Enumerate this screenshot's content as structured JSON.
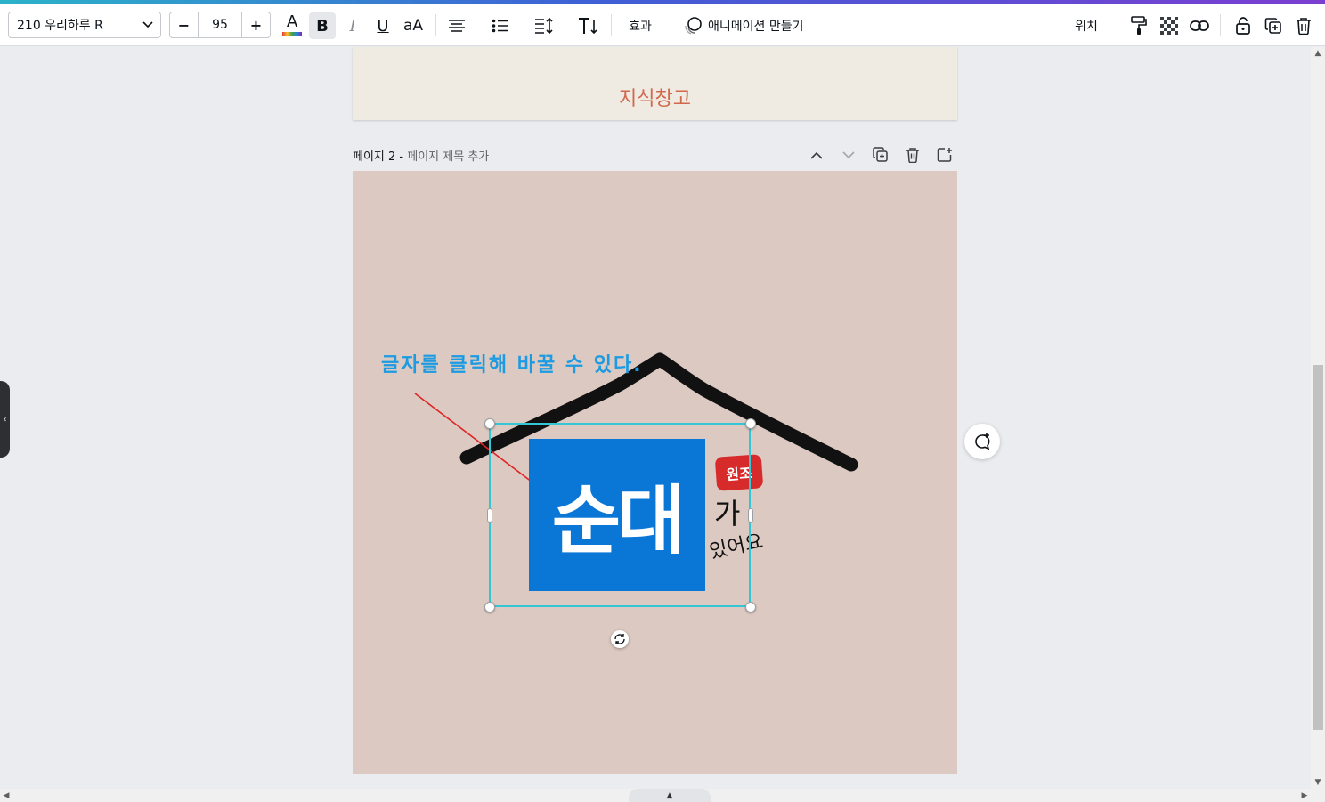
{
  "toolbar": {
    "font_name": "210 우리하루 R",
    "font_size": "95",
    "minus": "−",
    "plus": "+",
    "text_color_glyph": "A",
    "bold_glyph": "B",
    "italic_glyph": "I",
    "underline_glyph": "U",
    "case_glyph": "aA",
    "effects_label": "효과",
    "animate_label": "애니메이션 만들기",
    "position_label": "위치"
  },
  "page1": {
    "text": "지식창고"
  },
  "page2_header": {
    "page_label": "페이지 2 - ",
    "title_placeholder": "페이지 제목 추가"
  },
  "canvas": {
    "annotation": "글자를 클릭해 바꿀 수 있다.",
    "main_text": "순대",
    "badge_text": "원조",
    "side_text_1": "가",
    "side_text_2": "있어요"
  },
  "colors": {
    "accent_teal": "#34c6d4",
    "annotation_blue": "#1c9be3",
    "selection_fill": "#0a77d6",
    "page2_bg": "#dcc9c1",
    "page1_bg": "#efebe2",
    "page1_text": "#d1674b",
    "badge_red": "#d72a2a"
  },
  "icons": {
    "font_dropdown": "chevron-down-icon",
    "align": "align-center-icon",
    "list": "bullet-list-icon",
    "spacing": "line-spacing-icon",
    "vertical_text": "text-direction-icon",
    "animate": "animate-icon",
    "paint": "paint-roller-icon",
    "transparency": "checkerboard-icon",
    "link": "link-icon",
    "lock": "lock-icon",
    "duplicate": "duplicate-icon",
    "delete": "trash-icon",
    "collapse": "chevron-up-icon",
    "expand": "chevron-down-icon",
    "add_page": "add-page-icon",
    "comment": "comment-add-icon",
    "rotate": "rotate-icon"
  }
}
